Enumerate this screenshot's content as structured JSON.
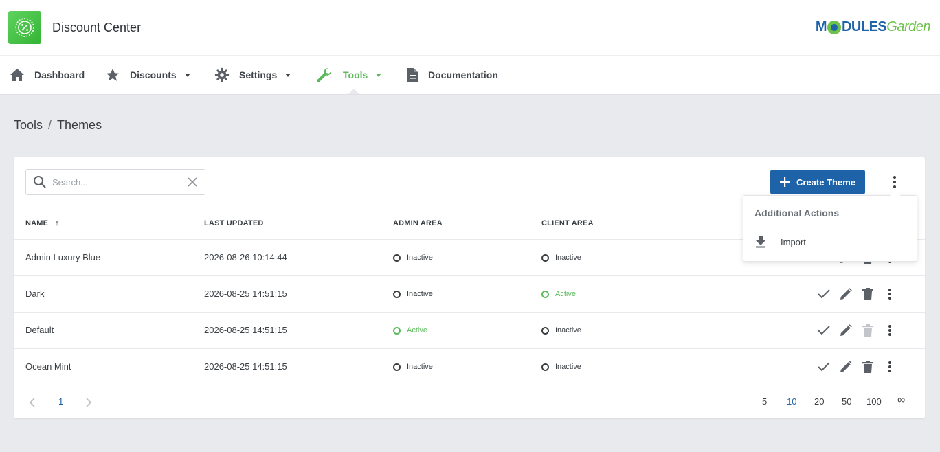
{
  "app": {
    "title": "Discount Center",
    "logo_icon": "discount-badge-icon"
  },
  "brand": {
    "part1": "M",
    "part2": "DULES",
    "part3": "Garden"
  },
  "nav": {
    "items": [
      {
        "label": "Dashboard",
        "icon": "home-icon",
        "dropdown": false,
        "active": false
      },
      {
        "label": "Discounts",
        "icon": "star-icon",
        "dropdown": true,
        "active": false
      },
      {
        "label": "Settings",
        "icon": "gear-icon",
        "dropdown": true,
        "active": false
      },
      {
        "label": "Tools",
        "icon": "wrench-icon",
        "dropdown": true,
        "active": true
      },
      {
        "label": "Documentation",
        "icon": "document-icon",
        "dropdown": false,
        "active": false
      }
    ]
  },
  "breadcrumb": {
    "parent": "Tools",
    "separator": "/",
    "current": "Themes"
  },
  "search": {
    "placeholder": "Search..."
  },
  "toolbar": {
    "create_label": "Create Theme"
  },
  "table": {
    "columns": [
      "NAME",
      "LAST UPDATED",
      "ADMIN AREA",
      "CLIENT AREA"
    ],
    "sort_indicator": "↑",
    "rows": [
      {
        "name": "Admin Luxury Blue",
        "updated": "2026-08-26 10:14:44",
        "admin": "Inactive",
        "client": "Inactive"
      },
      {
        "name": "Dark",
        "updated": "2026-08-25 14:51:15",
        "admin": "Inactive",
        "client": "Active"
      },
      {
        "name": "Default",
        "updated": "2026-08-25 14:51:15",
        "admin": "Active",
        "client": "Inactive"
      },
      {
        "name": "Ocean Mint",
        "updated": "2026-08-25 14:51:15",
        "admin": "Inactive",
        "client": "Inactive"
      }
    ]
  },
  "pagination": {
    "pages": [
      "1"
    ],
    "current": "1",
    "sizes": [
      "5",
      "10",
      "20",
      "50",
      "100",
      "∞"
    ],
    "current_size": "10"
  },
  "dropdown": {
    "title": "Additional Actions",
    "items": [
      {
        "label": "Import",
        "icon": "download-icon"
      }
    ]
  },
  "colors": {
    "primary": "#1e62a8",
    "active": "#5cba5c",
    "logo_green": "#3fbe3f"
  }
}
